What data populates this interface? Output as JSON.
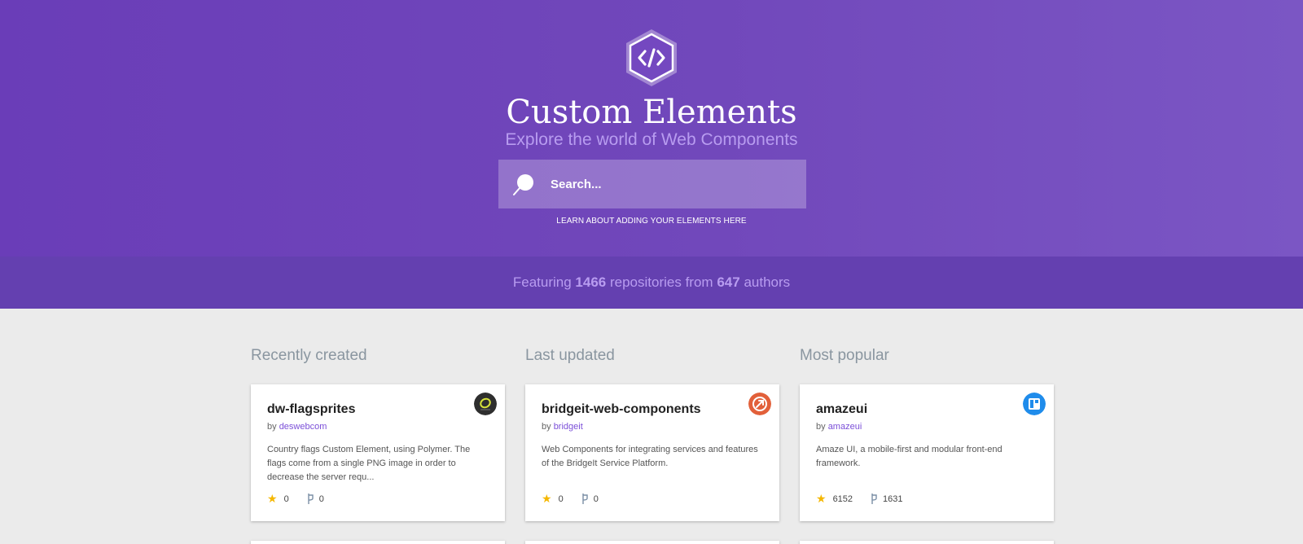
{
  "hero": {
    "title": "Custom Elements",
    "subtitle": "Explore the world of Web Components",
    "search_placeholder": "Search...",
    "learn_link": "LEARN ABOUT ADDING YOUR ELEMENTS HERE",
    "logo_icon": "code-hexagon-icon",
    "background_color": "#6a3db8"
  },
  "stats": {
    "prefix": "Featuring",
    "repositories": "1466",
    "middle": "repositories from",
    "authors": "647",
    "suffix": "authors"
  },
  "columns": [
    {
      "heading": "Recently created",
      "card": {
        "name": "dw-flagsprites",
        "by": "by",
        "author": "deswebcom",
        "description": "Country flags Custom Element, using Polymer. The flags come from a single PNG image in order to decrease the server requ...",
        "stars": "0",
        "forks": "0",
        "avatar_color": "#2e2e2e"
      }
    },
    {
      "heading": "Last updated",
      "card": {
        "name": "bridgeit-web-components",
        "by": "by",
        "author": "bridgeit",
        "description": "Web Components for integrating services and features of the BridgeIt Service Platform.",
        "stars": "0",
        "forks": "0",
        "avatar_color": "#e2603a"
      }
    },
    {
      "heading": "Most popular",
      "card": {
        "name": "amazeui",
        "by": "by",
        "author": "amazeui",
        "description": "Amaze UI, a mobile-first and modular front-end framework.",
        "stars": "6152",
        "forks": "1631",
        "avatar_color": "#1f8ceb"
      }
    }
  ],
  "colors": {
    "accent": "#7b4fd8",
    "star": "#f5b700",
    "stats_band": "#6440b0"
  }
}
